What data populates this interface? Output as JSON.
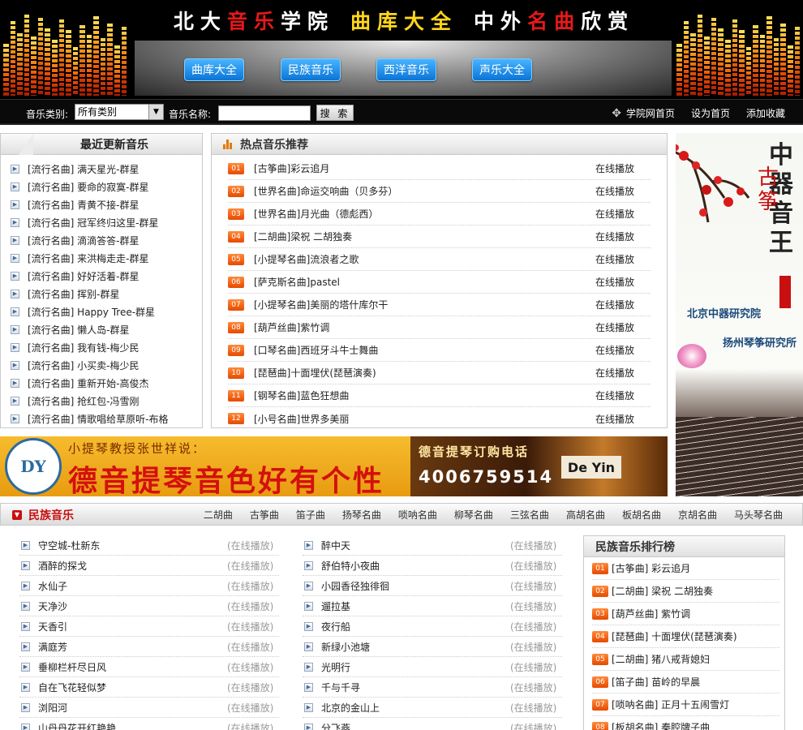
{
  "header": {
    "title_chars": [
      {
        "c": "北",
        "color": "#ffffff"
      },
      {
        "c": "大",
        "color": "#ffffff"
      },
      {
        "c": "音",
        "color": "#e8181a"
      },
      {
        "c": "乐",
        "color": "#e8181a"
      },
      {
        "c": "学",
        "color": "#ffffff"
      },
      {
        "c": "院",
        "color": "#ffffff"
      },
      {
        "c": " ",
        "color": "#ffffff"
      },
      {
        "c": "曲",
        "color": "#ffd71a"
      },
      {
        "c": "库",
        "color": "#ffd71a"
      },
      {
        "c": "大",
        "color": "#ffd71a"
      },
      {
        "c": "全",
        "color": "#ffd71a"
      },
      {
        "c": " ",
        "color": "#ffffff"
      },
      {
        "c": "中",
        "color": "#ffffff"
      },
      {
        "c": "外",
        "color": "#ffffff"
      },
      {
        "c": "名",
        "color": "#e8181a"
      },
      {
        "c": "曲",
        "color": "#e8181a"
      },
      {
        "c": "欣",
        "color": "#ffffff"
      },
      {
        "c": "赏",
        "color": "#ffffff"
      }
    ],
    "nav": [
      "曲库大全",
      "民族音乐",
      "西洋音乐",
      "声乐大全"
    ]
  },
  "search": {
    "type_label": "音乐类别:",
    "type_value": "所有类别",
    "name_label": "音乐名称:",
    "name_value": "",
    "button": "搜 索",
    "links": [
      "学院网首页",
      "设为首页",
      "添加收藏"
    ]
  },
  "latest": {
    "title": "最近更新音乐",
    "items": [
      "[流行名曲] 满天星光-群星",
      "[流行名曲] 要命的寂寞-群星",
      "[流行名曲] 青黄不接-群星",
      "[流行名曲] 冠军终归这里-群星",
      "[流行名曲] 滴滴答答-群星",
      "[流行名曲] 来洪梅走走-群星",
      "[流行名曲] 好好活着-群星",
      "[流行名曲] 挥别-群星",
      "[流行名曲] Happy Tree-群星",
      "[流行名曲] 懒人岛-群星",
      "[流行名曲] 我有钱-梅少民",
      "[流行名曲] 小买卖-梅少民",
      "[流行名曲] 重新开始-高俊杰",
      "[流行名曲] 抢红包-冯雪刚",
      "[流行名曲] 情歌唱给草原听-布格"
    ]
  },
  "hot": {
    "title": "热点音乐推荐",
    "play_label": "在线播放",
    "items": [
      {
        "n": "01",
        "t": "[古筝曲]彩云追月"
      },
      {
        "n": "02",
        "t": "[世界名曲]命运交响曲（贝多芬）"
      },
      {
        "n": "03",
        "t": "[世界名曲]月光曲（德彪西）"
      },
      {
        "n": "04",
        "t": "[二胡曲]梁祝 二胡独奏"
      },
      {
        "n": "05",
        "t": "[小提琴名曲]流浪者之歌"
      },
      {
        "n": "06",
        "t": "[萨克斯名曲]pastel"
      },
      {
        "n": "07",
        "t": "[小提琴名曲]美丽的塔什库尔干"
      },
      {
        "n": "08",
        "t": "[葫芦丝曲]紫竹调"
      },
      {
        "n": "09",
        "t": "[口琴名曲]西班牙斗牛士舞曲"
      },
      {
        "n": "10",
        "t": "[琵琶曲]十面埋伏(琵琶演奏)"
      },
      {
        "n": "11",
        "t": "[钢琴名曲]蓝色狂想曲"
      },
      {
        "n": "12",
        "t": "[小号名曲]世界多美丽"
      }
    ]
  },
  "ad_right": {
    "title": "中器音王",
    "subtitle": "古筝",
    "org1": "北京中器研究院",
    "org2": "扬州琴筝研究所"
  },
  "banner": {
    "logo": "DY",
    "sub": "小提琴教授张世祥说：",
    "main": "德音提琴音色好有个性",
    "phone_label": "德音提琴订购电话",
    "phone": "4006759514",
    "brand": "De Yin"
  },
  "folk": {
    "section": "民族音乐",
    "categories": [
      "二胡曲",
      "古筝曲",
      "笛子曲",
      "扬琴名曲",
      "唢呐名曲",
      "柳琴名曲",
      "三弦名曲",
      "高胡名曲",
      "板胡名曲",
      "京胡名曲",
      "马头琴名曲"
    ],
    "play_label": "(在线播放)",
    "col1": [
      "守空城-杜新东",
      "酒醉的探戈",
      "水仙子",
      "天净沙",
      "天香引",
      "满庭芳",
      "垂柳栏杆尽日风",
      "自在飞花轻似梦",
      "浏阳河",
      "山丹丹花开红艳艳"
    ],
    "col2": [
      "醉中天",
      "舒伯特小夜曲",
      "小园香径独徘徊",
      "遛拉基",
      "夜行船",
      "新绿小池塘",
      "光明行",
      "千与千寻",
      "北京的金山上",
      "分飞燕"
    ],
    "rank_title": "民族音乐排行榜",
    "rank": [
      {
        "n": "01",
        "t": "[古筝曲] 彩云追月"
      },
      {
        "n": "02",
        "t": "[二胡曲] 梁祝 二胡独奏"
      },
      {
        "n": "03",
        "t": "[葫芦丝曲] 紫竹调"
      },
      {
        "n": "04",
        "t": "[琵琶曲] 十面埋伏(琵琶演奏)"
      },
      {
        "n": "05",
        "t": "[二胡曲] 猪八戒背媳妇"
      },
      {
        "n": "06",
        "t": "[笛子曲] 苗岭的早晨"
      },
      {
        "n": "07",
        "t": "[唢呐名曲] 正月十五闹雪灯"
      },
      {
        "n": "08",
        "t": "[板胡名曲] 秦腔牌子曲"
      }
    ]
  }
}
